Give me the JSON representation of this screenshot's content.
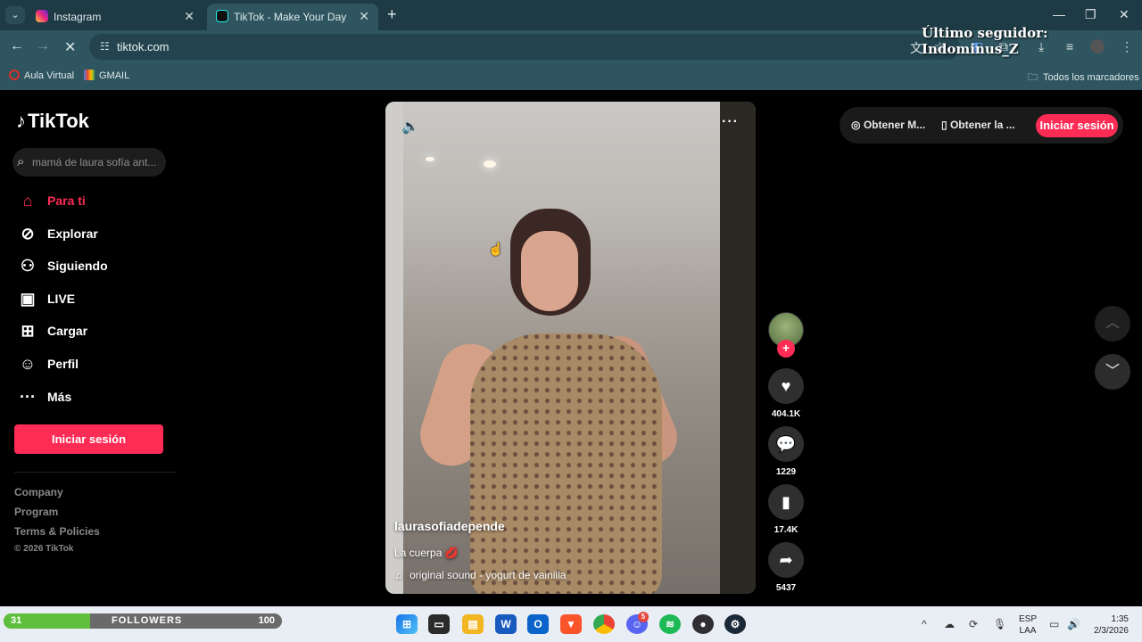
{
  "browser": {
    "tabs": [
      {
        "title": "Instagram",
        "icon": "instagram-icon",
        "active": false
      },
      {
        "title": "TikTok - Make Your Day",
        "icon": "tiktok-icon",
        "active": true
      }
    ],
    "url": "tiktok.com",
    "bookmarks": [
      {
        "label": "Aula Virtual",
        "icon": "aula-virtual-icon"
      },
      {
        "label": "GMAIL",
        "icon": "gmail-icon"
      }
    ],
    "all_bookmarks_label": "Todos los marcadores"
  },
  "stream_overlay": {
    "text": "Último seguidor: Indominus_Z"
  },
  "tiktok": {
    "logo_text": "TikTok",
    "search_placeholder": "mamá de laura sofía ant...",
    "nav": [
      {
        "label": "Para ti",
        "icon": "home-icon",
        "active": true
      },
      {
        "label": "Explorar",
        "icon": "compass-icon",
        "active": false
      },
      {
        "label": "Siguiendo",
        "icon": "following-icon",
        "active": false
      },
      {
        "label": "LIVE",
        "icon": "live-tv-icon",
        "active": false
      },
      {
        "label": "Cargar",
        "icon": "upload-icon",
        "active": false
      },
      {
        "label": "Perfil",
        "icon": "profile-icon",
        "active": false
      },
      {
        "label": "Más",
        "icon": "more-icon",
        "active": false
      }
    ],
    "login_label": "Iniciar sesión",
    "footer_links": [
      "Company",
      "Program",
      "Terms & Policies"
    ],
    "copyright": "© 2026 TikTok",
    "top_right": {
      "get_coins": "Obtener M...",
      "get_app": "Obtener la ...",
      "login": "Iniciar sesión"
    },
    "video": {
      "author": "laurasofiadepende",
      "caption": "La cuerpa 💋",
      "sound": "original sound - yogurt de vainilla"
    },
    "actions": {
      "likes": "404.1K",
      "comments": "1229",
      "saves": "17.4K",
      "shares": "5437"
    }
  },
  "followers_bar": {
    "start": "31",
    "label": "FOLLOWERS",
    "end": "100",
    "progress": 0.31
  },
  "taskbar": {
    "apps": [
      "windows-start-icon",
      "task-view-icon",
      "file-explorer-icon",
      "word-icon",
      "outlook-icon",
      "brave-icon",
      "chrome-icon",
      "discord-icon",
      "spotify-icon",
      "obs-icon",
      "steam-icon"
    ],
    "discord_badge": "5",
    "lang_line1": "ESP",
    "lang_line2": "LAA",
    "time": "1:35",
    "date": "2/3/2026"
  }
}
